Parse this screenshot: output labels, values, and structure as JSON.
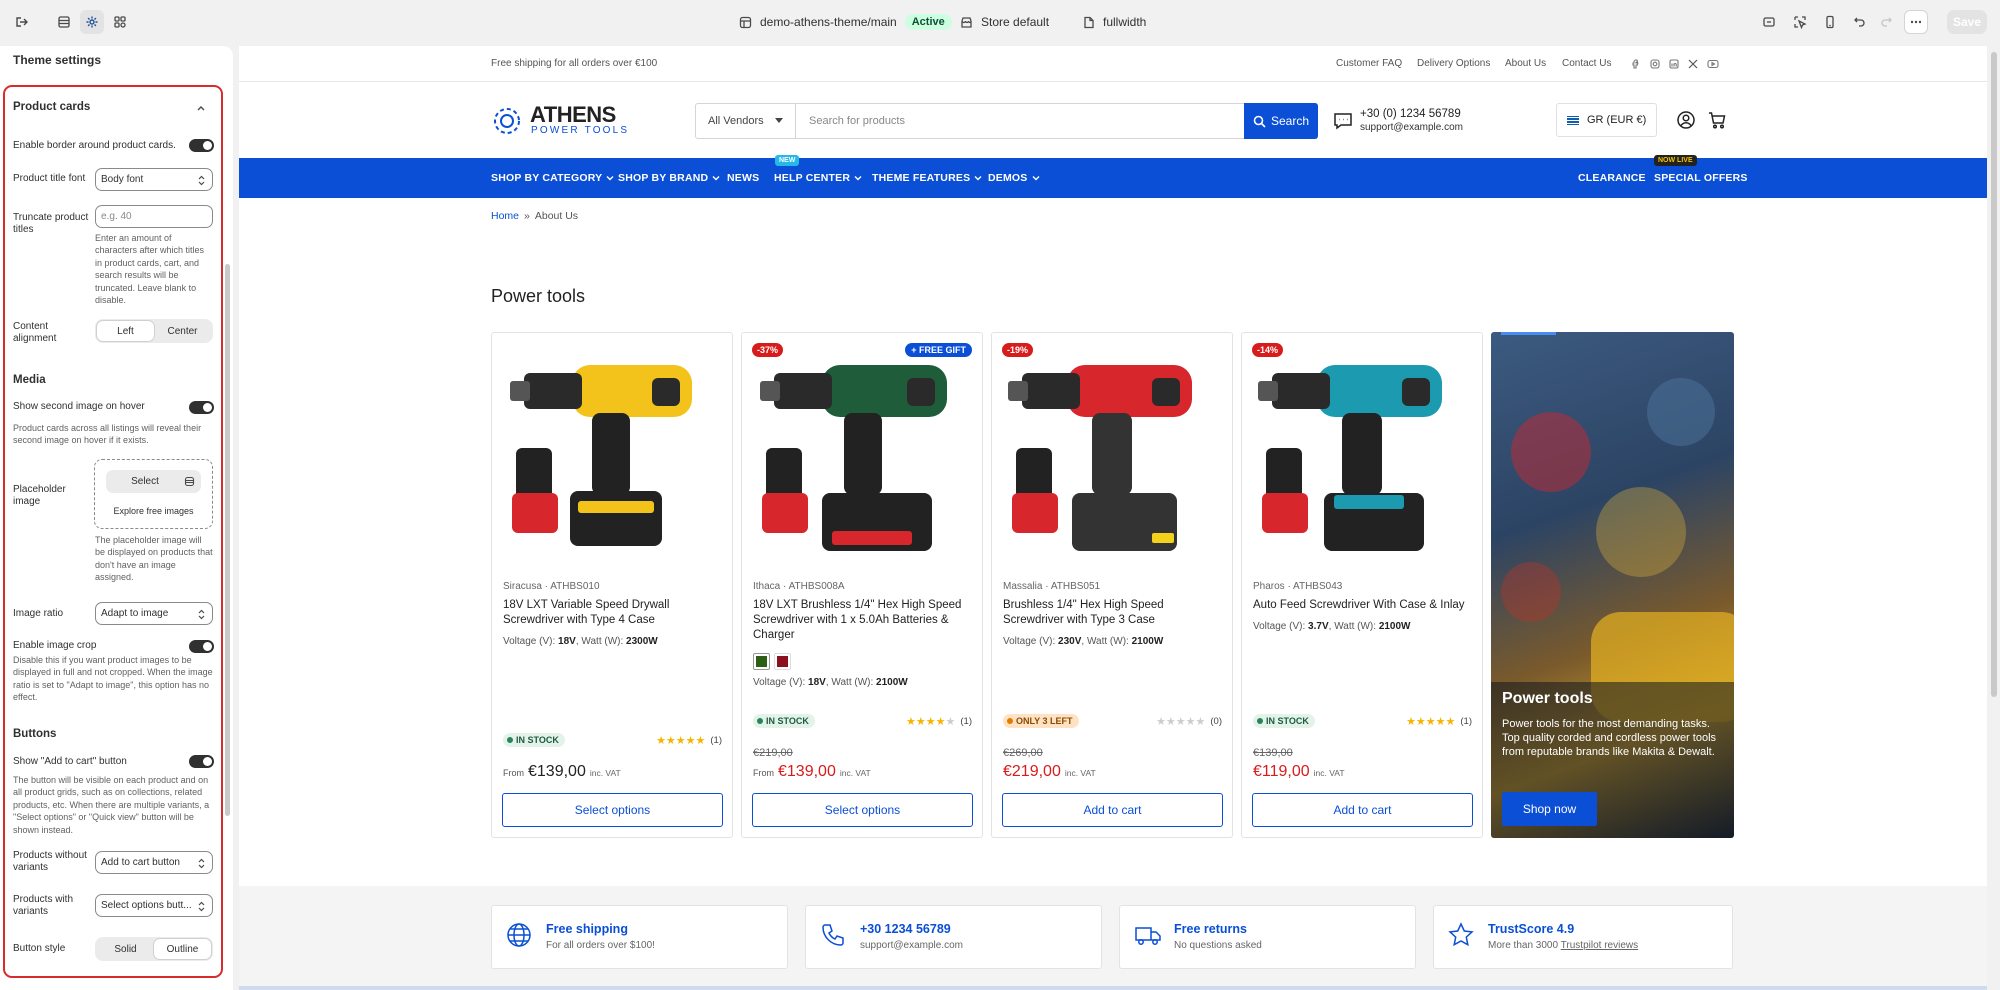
{
  "topbar": {
    "theme_name": "demo-athens-theme/main",
    "status_badge": "Active",
    "store": "Store default",
    "template": "fullwidth",
    "save_label": "Save"
  },
  "sidebar": {
    "title": "Theme settings",
    "section_title": "Product cards",
    "border_label": "Enable border around product cards.",
    "title_font_label": "Product title font",
    "title_font_value": "Body font",
    "truncate_label": "Truncate product titles",
    "truncate_placeholder": "e.g. 40",
    "truncate_hint": "Enter an amount of characters after which titles in product cards, cart, and search results will be truncated. Leave blank to disable.",
    "alignment_label": "Content alignment",
    "alignment_left": "Left",
    "alignment_center": "Center",
    "media_heading": "Media",
    "second_image_label": "Show second image on hover",
    "second_image_hint": "Product cards across all listings will reveal their second image on hover if it exists.",
    "placeholder_label": "Placeholder image",
    "placeholder_select": "Select",
    "placeholder_explore": "Explore free images",
    "placeholder_hint": "The placeholder image will be displayed on products that don't have an image assigned.",
    "image_ratio_label": "Image ratio",
    "image_ratio_value": "Adapt to image",
    "crop_label": "Enable image crop",
    "crop_hint": "Disable this if you want product images to be displayed in full and not cropped. When the image ratio is set to \"Adapt to image\", this option has no effect.",
    "buttons_heading": "Buttons",
    "add_to_cart_label": "Show \"Add to cart\" button",
    "add_to_cart_hint": "The button will be visible on each product and on all product grids, such as on collections, related products, etc. When there are multiple variants, a \"Select options\" or \"Quick view\" button will be shown instead.",
    "no_variants_label": "Products without variants",
    "no_variants_value": "Add to cart button",
    "with_variants_label": "Products with variants",
    "with_variants_value": "Select options butt...",
    "button_style_label": "Button style",
    "button_style_solid": "Solid",
    "button_style_outline": "Outline"
  },
  "store": {
    "announcement": "Free shipping for all orders over €100",
    "links": [
      "Customer FAQ",
      "Delivery Options",
      "About Us",
      "Contact Us"
    ],
    "logo_name": "ATHENS",
    "logo_sub": "POWER TOOLS",
    "vendor_select": "All Vendors",
    "search_placeholder": "Search for products",
    "search_button": "Search",
    "phone": "+30 (0) 1234 56789",
    "email": "support@example.com",
    "currency": "GR (EUR €)",
    "nav": [
      "SHOP BY CATEGORY",
      "SHOP BY BRAND",
      "NEWS",
      "HELP CENTER",
      "THEME FEATURES",
      "DEMOS"
    ],
    "nav_new_tag": "NEW",
    "nav_right": [
      "CLEARANCE",
      "SPECIAL OFFERS"
    ],
    "nav_live_tag": "NOW LIVE",
    "breadcrumb_home": "Home",
    "breadcrumb_sep": "»",
    "breadcrumb_current": "About Us",
    "section_title": "Power tools"
  },
  "products": [
    {
      "vendor": "Siracusa",
      "sku": "ATHBS010",
      "title": "18V LXT Variable Speed Drywall Screwdriver with Type 4 Case",
      "voltage": "18V",
      "watt": "2300W",
      "stock": "IN STOCK",
      "reviews": "(1)",
      "was": "",
      "from": "From",
      "price": "€139,00",
      "vat": "inc. VAT",
      "button": "Select options",
      "discount": "",
      "gift": ""
    },
    {
      "vendor": "Ithaca",
      "sku": "ATHBS008A",
      "title": "18V LXT Brushless 1/4\" Hex High Speed Screwdriver with 1 x 5.0Ah Batteries & Charger",
      "voltage": "18V",
      "watt": "2100W",
      "stock": "IN STOCK",
      "reviews": "(1)",
      "was": "€219,00",
      "from": "From",
      "price": "€139,00",
      "vat": "inc. VAT",
      "button": "Select options",
      "discount": "-37%",
      "gift": "+ FREE GIFT"
    },
    {
      "vendor": "Massalia",
      "sku": "ATHBS051",
      "title": "Brushless 1/4\" Hex High Speed Screwdriver with Type 3 Case",
      "voltage": "230V",
      "watt": "2100W",
      "stock": "ONLY 3 LEFT",
      "reviews": "(0)",
      "was": "€269,00",
      "from": "",
      "price": "€219,00",
      "vat": "inc. VAT",
      "button": "Add to cart",
      "discount": "-19%",
      "gift": ""
    },
    {
      "vendor": "Pharos",
      "sku": "ATHBS043",
      "title": "Auto Feed Screwdriver With Case & Inlay",
      "voltage": "3.7V",
      "watt": "2100W",
      "stock": "IN STOCK",
      "reviews": "(1)",
      "was": "€139,00",
      "from": "",
      "price": "€119,00",
      "vat": "inc. VAT",
      "button": "Add to cart",
      "discount": "-14%",
      "gift": ""
    }
  ],
  "spec_labels": {
    "voltage": "Voltage (V):",
    "watt": "Watt (W):"
  },
  "promo": {
    "title": "Power tools",
    "text": "Power tools for the most demanding tasks. Top quality corded and cordless power tools from reputable brands like Makita & Dewalt.",
    "button": "Shop now"
  },
  "features": [
    {
      "title": "Free shipping",
      "desc": "For all orders over $100!"
    },
    {
      "title": "+30 1234 56789",
      "desc": "support@example.com"
    },
    {
      "title": "Free returns",
      "desc": "No questions asked"
    },
    {
      "title": "TrustScore 4.9",
      "desc": "More than 3000",
      "link": "Trustpilot reviews"
    }
  ],
  "colors": {
    "accent": "#0a4fd6",
    "sale": "#d71c1c",
    "highlight": "#d82c2c",
    "stock": "#29845a",
    "stars": "#f5b400"
  }
}
